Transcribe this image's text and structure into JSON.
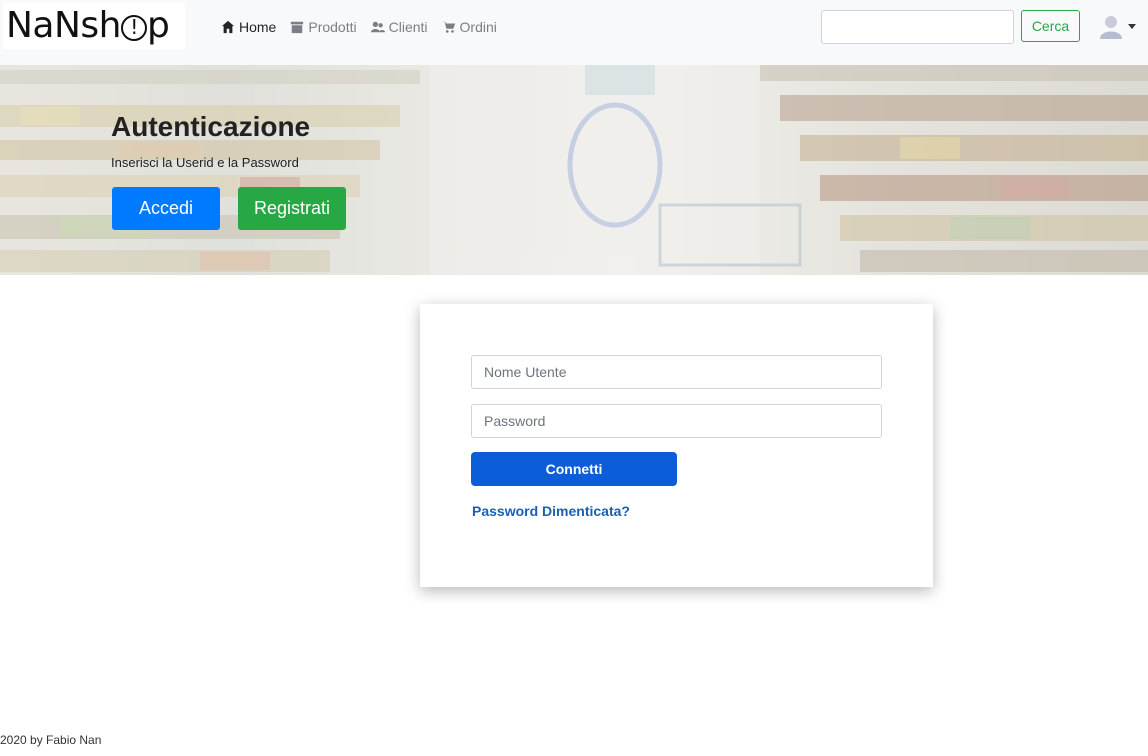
{
  "header": {
    "logo_text": "NaNshop",
    "nav": [
      {
        "label": "Home",
        "icon": "home-icon",
        "active": true
      },
      {
        "label": "Prodotti",
        "icon": "archive-icon",
        "active": false
      },
      {
        "label": "Clienti",
        "icon": "people-icon",
        "active": false
      },
      {
        "label": "Ordini",
        "icon": "cart-icon",
        "active": false
      }
    ],
    "search": {
      "placeholder": "",
      "button_label": "Cerca"
    },
    "user_icon": "user-avatar-icon"
  },
  "hero": {
    "title": "Autenticazione",
    "subtitle": "Inserisci la Userid e la Password",
    "login_button": "Accedi",
    "register_button": "Registrati"
  },
  "login": {
    "username_placeholder": "Nome Utente",
    "password_placeholder": "Password",
    "submit_label": "Connetti",
    "forgot_link": "Password Dimenticata?"
  },
  "footer": {
    "text": "2020 by Fabio Nan"
  },
  "colors": {
    "primary": "#007bff",
    "success": "#28a745",
    "connect_button": "#0b5ed7",
    "link": "#1a5fb4",
    "navbar_bg": "#f8f9fa"
  }
}
